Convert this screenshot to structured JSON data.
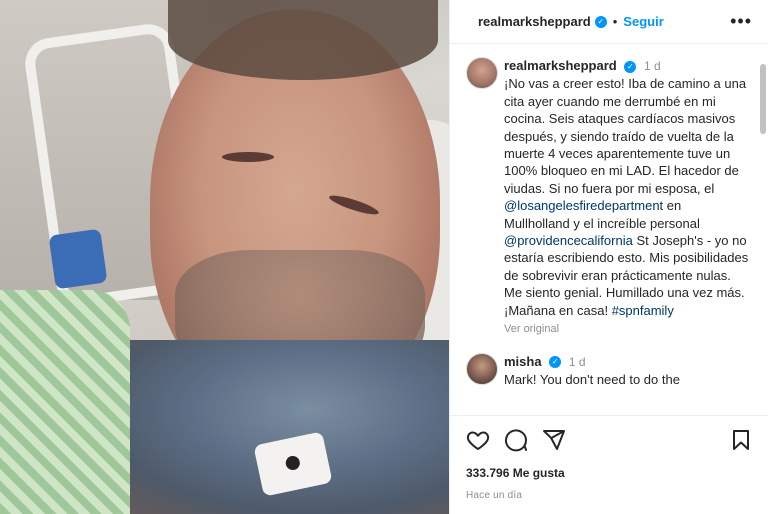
{
  "header": {
    "username": "realmarksheppard",
    "separator": "•",
    "follow_label": "Seguir",
    "more_label": "•••"
  },
  "post": {
    "username": "realmarksheppard",
    "time": "1 d",
    "text_1": "¡No vas a creer esto! Iba de camino a una cita ayer cuando me derrumbé en mi cocina. Seis ataques cardíacos masivos después, y siendo traído de vuelta de la muerte 4 veces aparentemente tuve un 100% bloqueo en mi LAD. El hacedor de viudas. Si no fuera por mi esposa, el ",
    "mention_1": "@losangelesfiredepartment",
    "text_2": " en Mullholland y el increíble personal ",
    "mention_2": "@providencecalifornia",
    "text_3": " St Joseph's - yo no estaría escribiendo esto. Mis posibilidades de sobrevivir eran prácticamente nulas. Me siento genial. Humillado una vez más. ¡Mañana en casa! ",
    "hashtag": "#spnfamily",
    "see_original": "Ver original"
  },
  "comment": {
    "username": "misha",
    "time": "1 d",
    "text": "Mark! You don't need to do the"
  },
  "likes": "333.796 Me gusta",
  "posted_ago": "Hace un día",
  "icons": {
    "like": "heart-icon",
    "comment": "comment-icon",
    "share": "share-icon",
    "save": "bookmark-icon",
    "verified": "verified-badge-icon",
    "more": "more-options-icon"
  },
  "colors": {
    "accent": "#0095f6",
    "link": "#00376b",
    "muted": "#8e8e8e",
    "text": "#262626"
  }
}
